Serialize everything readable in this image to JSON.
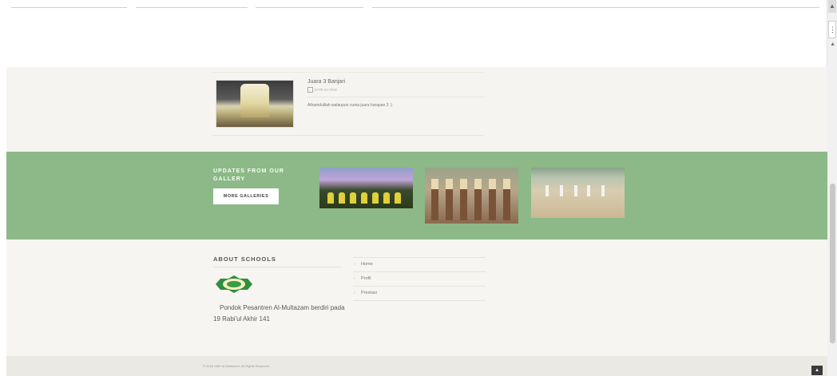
{
  "news": {
    "title": "Juara 3 Banjari",
    "date": "on 05 Jun 2018",
    "excerpt": "Alhamdulilah walaupun cuma juara harapan 3 :)"
  },
  "gallery": {
    "heading": "UPDATES FROM OUR GALLERY",
    "button_label": "MORE GALLERIES"
  },
  "about": {
    "title": "ABOUT SCHOOLS",
    "text": "Pondok Pesantren Al-Multazam berdiri pada 19 Rabi'ul Akhir 141",
    "links": [
      {
        "label": "Home"
      },
      {
        "label": "Profil"
      },
      {
        "label": "Prestasi"
      }
    ]
  },
  "footer": {
    "copyright": "© 2018 SMP Al-Multazam. All Rights Reserved"
  },
  "colors": {
    "gallery_band": "#8cb987",
    "section_bg": "#f5f4f0",
    "footer_bg": "#ebe9e3",
    "logo_green": "#2f8f3f"
  },
  "icons": {
    "back_to_top": "chevron-up-icon",
    "calendar": "calendar-icon",
    "link_bullet": "chevron-right-icon"
  }
}
